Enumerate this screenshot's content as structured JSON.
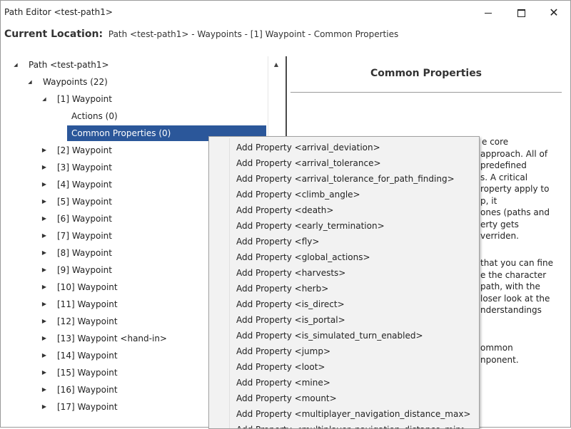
{
  "window": {
    "title": "Path Editor <test-path1>",
    "controls": {
      "minimize": "minimize-icon",
      "maximize": "maximize-icon",
      "close": "close-icon"
    }
  },
  "location": {
    "label": "Current Location:",
    "path": "Path <test-path1> - Waypoints - [1] Waypoint - Common Properties"
  },
  "tree": [
    {
      "label": "Path <test-path1>",
      "level": 0,
      "expander": "expanded"
    },
    {
      "label": "Waypoints (22)",
      "level": 1,
      "expander": "expanded"
    },
    {
      "label": "[1] Waypoint",
      "level": 2,
      "expander": "expanded"
    },
    {
      "label": "Actions (0)",
      "level": 3,
      "expander": "none"
    },
    {
      "label": "Common Properties (0)",
      "level": 3,
      "expander": "none",
      "selected": true
    },
    {
      "label": "[2] Waypoint",
      "level": 2,
      "expander": "collapsed"
    },
    {
      "label": "[3] Waypoint",
      "level": 2,
      "expander": "collapsed"
    },
    {
      "label": "[4] Waypoint",
      "level": 2,
      "expander": "collapsed"
    },
    {
      "label": "[5] Waypoint",
      "level": 2,
      "expander": "collapsed"
    },
    {
      "label": "[6] Waypoint",
      "level": 2,
      "expander": "collapsed"
    },
    {
      "label": "[7] Waypoint",
      "level": 2,
      "expander": "collapsed"
    },
    {
      "label": "[8] Waypoint",
      "level": 2,
      "expander": "collapsed"
    },
    {
      "label": "[9] Waypoint",
      "level": 2,
      "expander": "collapsed"
    },
    {
      "label": "[10] Waypoint",
      "level": 2,
      "expander": "collapsed"
    },
    {
      "label": "[11] Waypoint",
      "level": 2,
      "expander": "collapsed"
    },
    {
      "label": "[12] Waypoint",
      "level": 2,
      "expander": "collapsed"
    },
    {
      "label": "[13] Waypoint <hand-in>",
      "level": 2,
      "expander": "collapsed"
    },
    {
      "label": "[14] Waypoint",
      "level": 2,
      "expander": "collapsed"
    },
    {
      "label": "[15] Waypoint",
      "level": 2,
      "expander": "collapsed"
    },
    {
      "label": "[16] Waypoint",
      "level": 2,
      "expander": "collapsed"
    },
    {
      "label": "[17] Waypoint",
      "level": 2,
      "expander": "collapsed"
    }
  ],
  "properties": {
    "title": "Common Properties",
    "paragraphs": [
      [
        "e core",
        "approach. All of",
        "predefined",
        "s. A critical",
        "roperty apply to",
        "p, it",
        "ones (paths and",
        "erty gets",
        "verriden."
      ],
      [
        "that you can fine",
        "e the character",
        "path, with the",
        "loser look at the",
        "nderstandings"
      ],
      [
        "ommon",
        "nponent."
      ]
    ]
  },
  "context_menu": {
    "items": [
      "Add Property <arrival_deviation>",
      "Add Property <arrival_tolerance>",
      "Add Property <arrival_tolerance_for_path_finding>",
      "Add Property <climb_angle>",
      "Add Property <death>",
      "Add Property <early_termination>",
      "Add Property <fly>",
      "Add Property <global_actions>",
      "Add Property <harvests>",
      "Add Property <herb>",
      "Add Property <is_direct>",
      "Add Property <is_portal>",
      "Add Property <is_simulated_turn_enabled>",
      "Add Property <jump>",
      "Add Property <loot>",
      "Add Property <mine>",
      "Add Property <mount>",
      "Add Property <multiplayer_navigation_distance_max>",
      "Add Property <multiplayer_navigation_distance_min>"
    ]
  },
  "icons": {
    "expanded": "triangle-expanded-icon",
    "collapsed": "triangle-collapsed-icon",
    "scroll_up": "scroll-up-icon"
  },
  "colors": {
    "selection": "#2b579a",
    "menu_bg": "#f2f2f2",
    "splitter": "#4a4a4a"
  }
}
